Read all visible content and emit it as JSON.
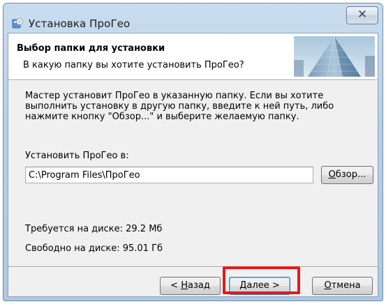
{
  "window": {
    "title": "Установка ПроГео",
    "close_glyph": "✕"
  },
  "header": {
    "title": "Выбор папки для установки",
    "subtitle": "В какую папку вы хотите установить ПроГео?"
  },
  "body": {
    "description_lines": [
      "Мастер установит ПроГео в указанную папку. Если вы хотите",
      "выполнить установку в другую папку, введите к ней путь, либо",
      "нажмите кнопку \"Обзор...\" и выберите желаемую папку."
    ],
    "install_label": "Установить ПроГео в:",
    "install_path": "C:\\Program Files\\ПроГео",
    "browse_accel": "О",
    "browse_rest": "бзор...",
    "required_space": "Требуется на диске: 29.2 Мб",
    "free_space": "Свободно на диске:  95.01 Гб"
  },
  "buttons": {
    "back_prefix": "< ",
    "back_accel": "Н",
    "back_rest": "азад",
    "next_accel": "Д",
    "next_rest": "алее >",
    "cancel_accel": "О",
    "cancel_rest": "тмена"
  },
  "icons": {
    "title_icon": "installer-cd-icon",
    "header_image": "skyscraper-image"
  },
  "colors": {
    "highlight": "#e11b1b",
    "titlebar": "#b7cfe6",
    "default_button_border": "#3c7fb1"
  }
}
